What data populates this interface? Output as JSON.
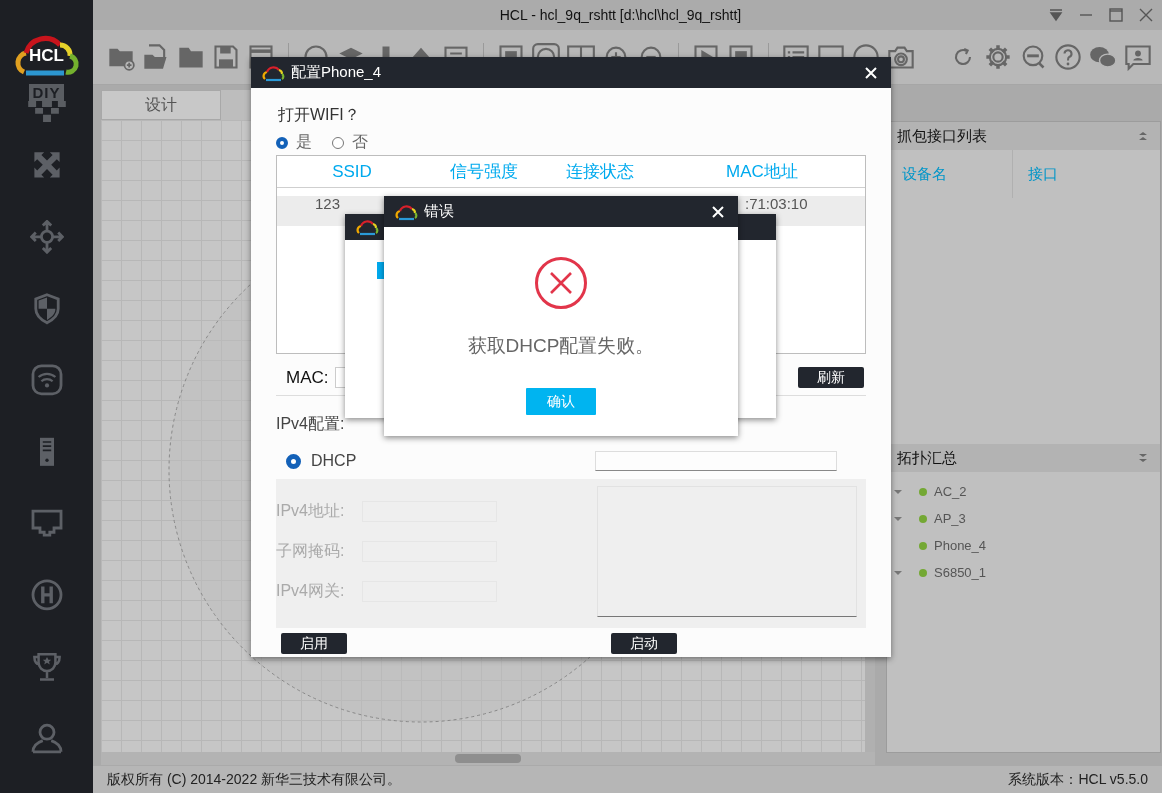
{
  "window": {
    "title": "HCL - hcl_9q_rshtt [d:\\hcl\\hcl_9q_rshtt]"
  },
  "sidebar": {
    "logo_text": "HCL",
    "diy_text": "DIY"
  },
  "tabs": [
    {
      "label": "设计",
      "selected": true
    }
  ],
  "capture_panel": {
    "title": "抓包接口列表",
    "columns": [
      "设备名",
      "接口"
    ]
  },
  "topology_panel": {
    "title": "拓扑汇总",
    "items": [
      {
        "name": "AC_2",
        "expandable": true
      },
      {
        "name": "AP_3",
        "expandable": true
      },
      {
        "name": "Phone_4",
        "expandable": false
      },
      {
        "name": "S6850_1",
        "expandable": true
      }
    ]
  },
  "status_bar": {
    "copyright": "版权所有 (C) 2014-2022 新华三技术有限公司。",
    "version": "系统版本：HCL v5.5.0"
  },
  "config_dialog": {
    "title": "配置Phone_4",
    "wifi_question": "打开WIFI？",
    "wifi_options": [
      {
        "label": "是",
        "selected": true
      },
      {
        "label": "否",
        "selected": false
      }
    ],
    "wifi_table": {
      "columns": [
        "SSID",
        "信号强度",
        "连接状态",
        "MAC地址"
      ],
      "rows": [
        {
          "ssid": "123",
          "mac": ":71:03:10"
        }
      ]
    },
    "mac_label": "MAC:",
    "refresh_button": "刷新",
    "ipv4_label": "IPv4配置:",
    "dhcp": {
      "label": "DHCP",
      "selected": true
    },
    "fields": [
      {
        "label": "IPv4地址:",
        "disabled": true
      },
      {
        "label": "子网掩码:",
        "disabled": true
      },
      {
        "label": "IPv4网关:",
        "disabled": true
      }
    ],
    "apply_button": "启用",
    "start_button": "启动"
  },
  "error_dialog": {
    "title": "错误",
    "message": "获取DHCP配置失败。",
    "confirm_button": "确认"
  }
}
